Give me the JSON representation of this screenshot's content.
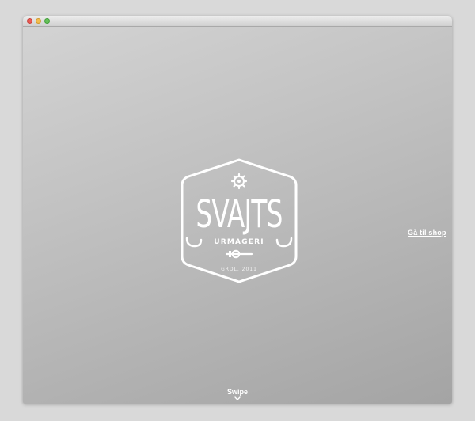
{
  "logo": {
    "brand": "SVAJTS",
    "subtitle": "URMAGERI",
    "established": "GRDL. 2011"
  },
  "nav": {
    "shop_link": "Gå til shop"
  },
  "swipe": {
    "label": "Swipe",
    "icon": "chevron-down-icon"
  },
  "icons": {
    "logo_top": "gear-icon",
    "logo_bottom": "watch-crown-icon"
  },
  "colors": {
    "text": "#ffffff",
    "background_light": "#d3d3d3",
    "background_dark": "#a4a4a4"
  }
}
